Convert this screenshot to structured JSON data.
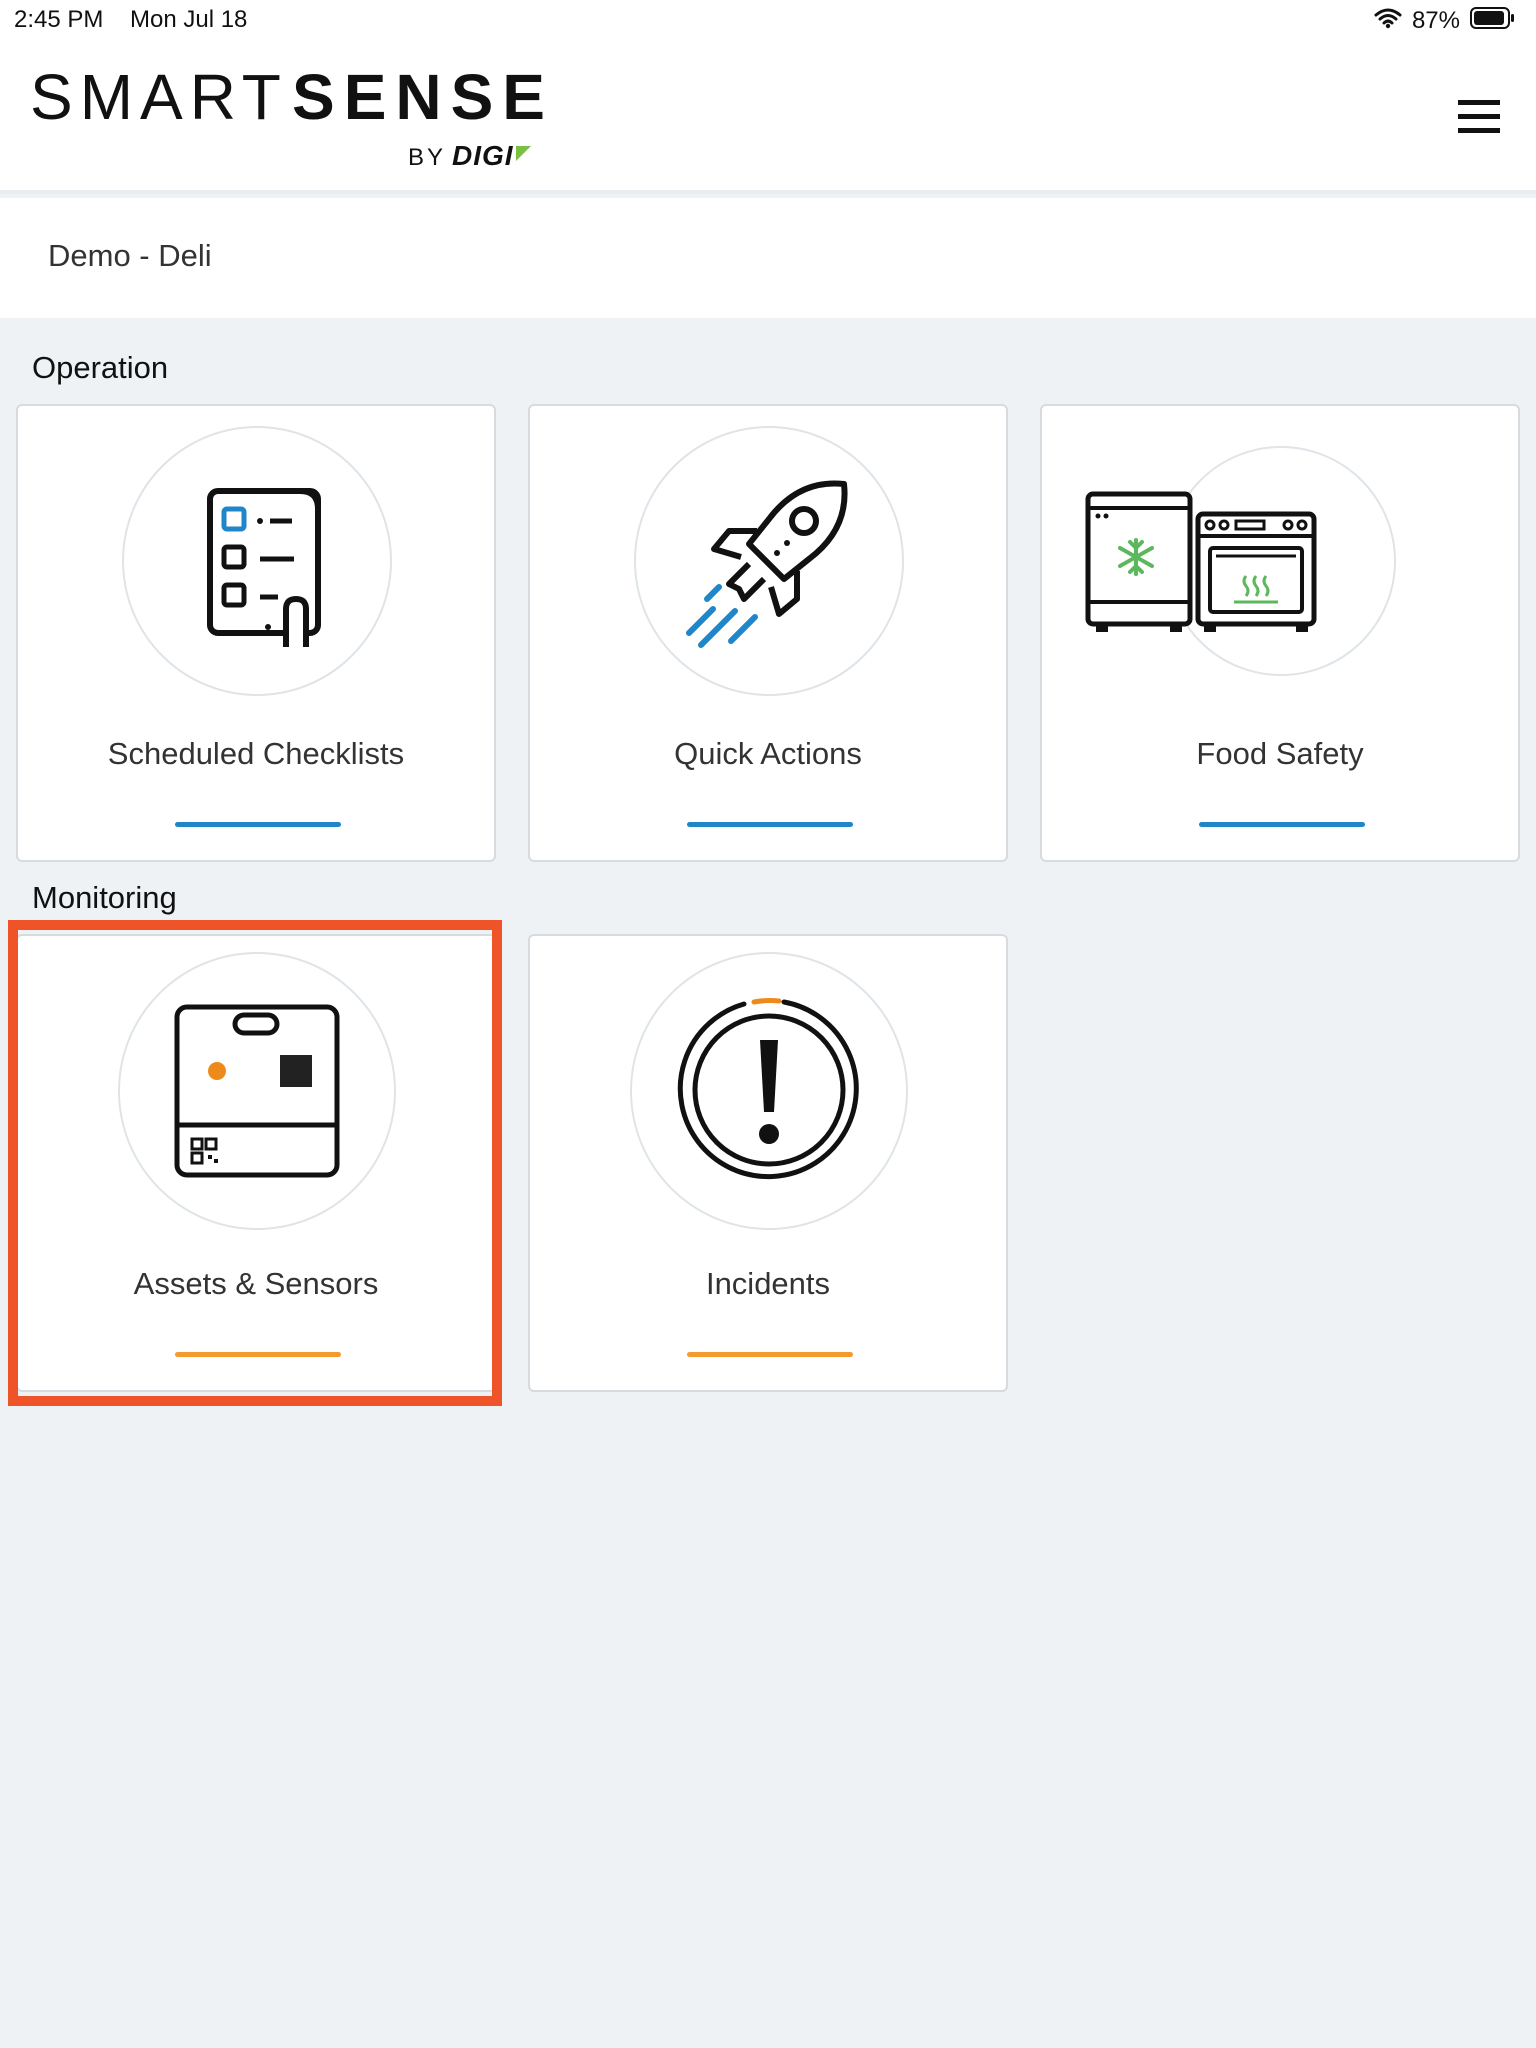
{
  "status_bar": {
    "time": "2:45 PM",
    "date": "Mon Jul 18",
    "battery": "87%"
  },
  "header": {
    "logo_smart": "SMART",
    "logo_sense": "SENSE",
    "logo_by": "BY",
    "logo_digi": "DIGI",
    "menu_icon": "hamburger-menu-icon"
  },
  "site": {
    "name": "Demo - Deli"
  },
  "sections": {
    "operation": {
      "title": "Operation",
      "cards": [
        {
          "label": "Scheduled Checklists",
          "icon": "checklist-icon",
          "accent": "#1f86c9"
        },
        {
          "label": "Quick Actions",
          "icon": "rocket-icon",
          "accent": "#1f86c9"
        },
        {
          "label": "Food Safety",
          "icon": "freezer-oven-icon",
          "accent": "#1f86c9"
        }
      ]
    },
    "monitoring": {
      "title": "Monitoring",
      "cards": [
        {
          "label": "Assets & Sensors",
          "icon": "sensor-device-icon",
          "accent": "#f59a2f"
        },
        {
          "label": "Incidents",
          "icon": "alert-icon",
          "accent": "#f59a2f"
        }
      ]
    }
  },
  "colors": {
    "highlight": "#ee5428",
    "blue_accent": "#1f86c9",
    "orange_accent": "#f59a2f",
    "digi_green": "#7ac143"
  }
}
